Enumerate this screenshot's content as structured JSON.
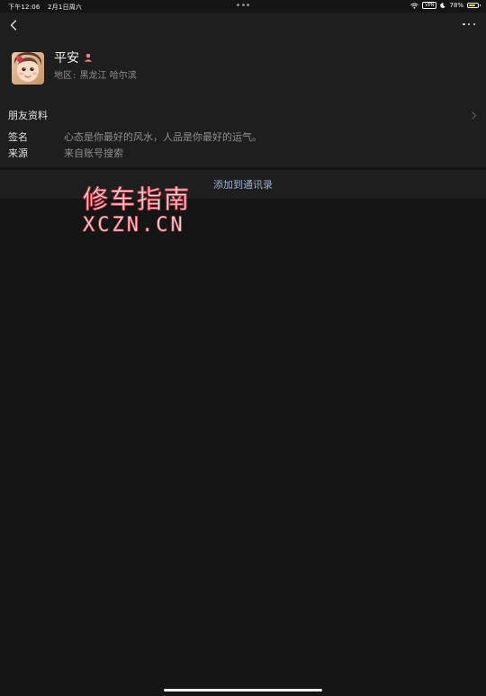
{
  "status_bar": {
    "time": "下午12:06",
    "date": "2月1日周六",
    "vpn": "VPN",
    "battery": "78%",
    "battery_level": 0.78,
    "battery_color": "#f5d547"
  },
  "header": {
    "back_icon": "chevron-left-icon",
    "more_icon": "ellipsis-icon"
  },
  "profile": {
    "name": "平安",
    "gender_icon": "female-person-icon",
    "region_label": "地区",
    "region_separator": ":",
    "region_value": "黑龙江 哈尔滨"
  },
  "friend_info": {
    "title": "朋友资料",
    "signature_label": "签名",
    "signature_value": "心态是你最好的风水，人品是你最好的运气。",
    "source_label": "来源",
    "source_value": "来自账号搜索"
  },
  "actions": {
    "add_contact": "添加到通讯录",
    "link_color": "#9bb1d2"
  },
  "watermark": {
    "cn": "修车指南",
    "en": "XCZN.CN"
  }
}
